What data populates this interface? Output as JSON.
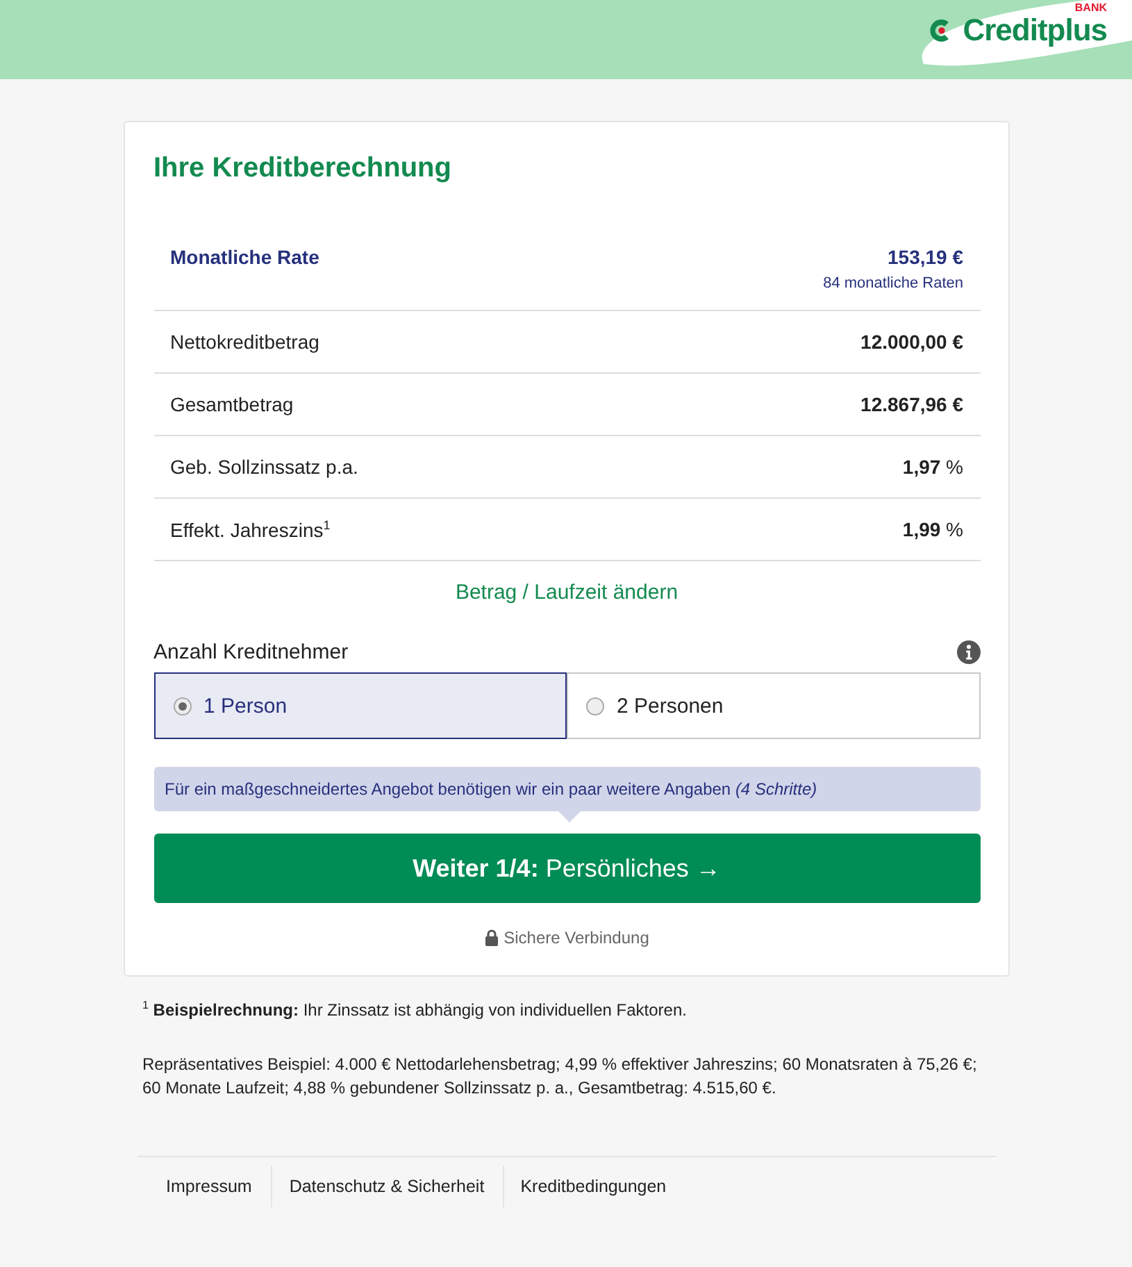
{
  "header": {
    "logo": {
      "name": "Creditplus",
      "badge": "BANK"
    }
  },
  "card": {
    "title": "Ihre Kreditberechnung",
    "highlight": {
      "label": "Monatliche Rate",
      "value": "153,19 €",
      "note": "84 monatliche Raten"
    },
    "rows": [
      {
        "label": "Nettokreditbetrag",
        "value": "**12.000,00 €**"
      },
      {
        "label": "Gesamtbetrag",
        "value": "**12.867,96 €**"
      },
      {
        "label": "Geb. Sollzinssatz p.a.",
        "value": "**1,97** %"
      },
      {
        "label": "Effekt. Jahreszins$^{1}$",
        "value": "**1,99** %"
      }
    ],
    "change_link": "Betrag / Laufzeit ändern",
    "borrowers": {
      "label": "Anzahl Kreditnehmer",
      "options": [
        {
          "label": "1 Person",
          "selected": true
        },
        {
          "label": "2 Personen",
          "selected": false
        }
      ]
    },
    "hint": "Für ein maßgeschneidertes Angebot benötigen wir ein paar weitere Angaben *(4 Schritte)*",
    "next_button": "**Weiter 1/4:** Persönliches →",
    "secure": "Sichere Verbindung"
  },
  "notes": [
    "$^{1}$ **Beispielrechnung:** Ihr Zinssatz ist abhängig von individuellen Faktoren.",
    "Repräsentatives Beispiel: 4.000 € Nettodarlehensbetrag; 4,99 % effektiver Jahreszins; 60 Monatsraten à 75,26 €; 60 Monate Laufzeit; 4,88 % gebundener Sollzinssatz p. a., Gesamtbetrag: 4.515,60 €."
  ],
  "footer": [
    "Impressum",
    "Datenschutz & Sicherheit",
    "Kreditbedingungen"
  ]
}
